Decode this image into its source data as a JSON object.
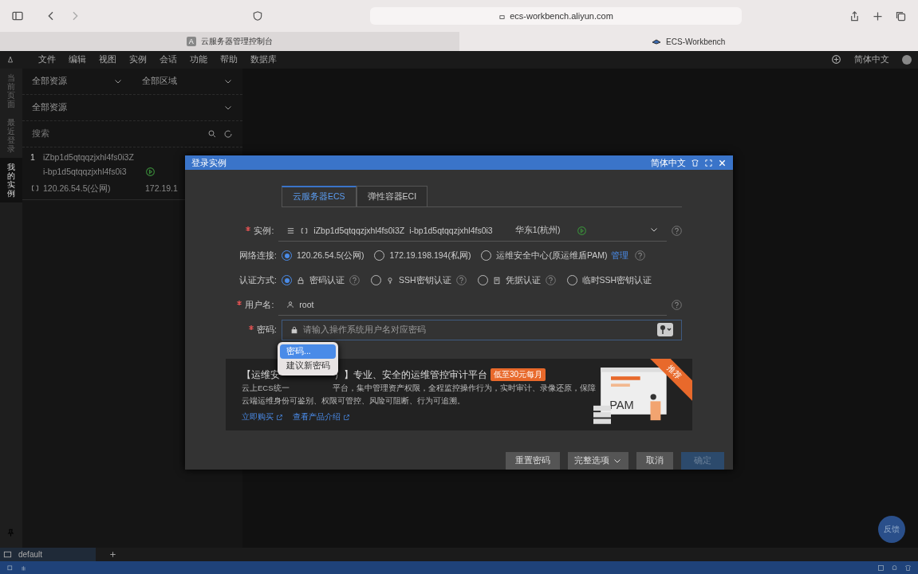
{
  "browser": {
    "url": "ecs-workbench.aliyun.com",
    "tabs": [
      {
        "label": "云服务器管理控制台",
        "badge": "A",
        "selected": false
      },
      {
        "label": "ECS-Workbench",
        "selected": true
      }
    ]
  },
  "menubar": {
    "items": [
      "文件",
      "编辑",
      "视图",
      "实例",
      "会话",
      "功能",
      "帮助",
      "数据库"
    ],
    "language": "简体中文"
  },
  "side_tabs": [
    {
      "label": "当前页面",
      "selected": false
    },
    {
      "label": "最近登录",
      "selected": false
    },
    {
      "label": "我的实例",
      "selected": true
    }
  ],
  "sidebar": {
    "filters": [
      [
        "全部资源",
        "全部区域"
      ],
      [
        "全部资源"
      ]
    ],
    "search": {
      "placeholder": "搜索"
    },
    "instances": [
      {
        "index": "1",
        "name": "iZbp1d5qtqqzjxhl4fs0i3Z",
        "id": "i-bp1d5qtqqzjxhl4fs0i3",
        "public_ip": "120.26.54.5(公网)",
        "private_ip": "172.19.1"
      }
    ]
  },
  "dialog": {
    "title": "登录实例",
    "language": "简体中文",
    "tabs": [
      {
        "label": "云服务器ECS",
        "selected": true
      },
      {
        "label": "弹性容器ECI",
        "selected": false
      }
    ],
    "instance": {
      "label": "实例:",
      "required": true,
      "name": "iZbp1d5qtqqzjxhl4fs0i3Z",
      "id": "i-bp1d5qtqqzjxhl4fs0i3",
      "region": "华东1(杭州)"
    },
    "network": {
      "label": "网络连接:",
      "options": [
        {
          "label": "120.26.54.5(公网)",
          "selected": true
        },
        {
          "label": "172.19.198.194(私网)",
          "selected": false
        },
        {
          "label": "运维安全中心(原运维盾PAM)",
          "selected": false,
          "link": "管理"
        }
      ]
    },
    "auth": {
      "label": "认证方式:",
      "options": [
        {
          "label": "密码认证",
          "kind": "password",
          "help": true,
          "selected": true
        },
        {
          "label": "SSH密钥认证",
          "kind": "ssh_key",
          "help": true,
          "selected": false
        },
        {
          "label": "凭据认证",
          "kind": "credential",
          "help": true,
          "selected": false
        },
        {
          "label": "临时SSH密钥认证",
          "kind": "temp_ssh",
          "help": false,
          "selected": false
        }
      ]
    },
    "username": {
      "label": "用户名:",
      "required": true,
      "value": "root"
    },
    "password": {
      "label": "密码:",
      "required": true,
      "placeholder": "请输入操作系统用户名对应密码"
    },
    "autofill_menu": [
      {
        "label": "密码...",
        "selected": true
      },
      {
        "label": "建议新密码",
        "selected": false
      }
    ],
    "banner": {
      "title_start": "【运维安",
      "title_end": "）】专业、安全的运维管控审计平台",
      "tag": "低至30元每月",
      "desc_start": "云上ECS统一",
      "desc_end": "平台，集中管理资产权限，全程监控操作行为，实时审计、录像还原，保障",
      "desc_line2": "云端运维身份可鉴别、权限可管控、风险可阻断、行为可追溯。",
      "links": [
        "立即购买",
        "查看产品介绍"
      ],
      "ribbon": "推荐",
      "art_label": "PAM"
    },
    "buttons": [
      {
        "label": "重置密码",
        "kind": "plain"
      },
      {
        "label": "完整选项",
        "kind": "dropdown"
      },
      {
        "label": "取消",
        "kind": "plain"
      },
      {
        "label": "确定",
        "kind": "primary",
        "disabled": true
      }
    ]
  },
  "feedback": "反馈",
  "terminal_tab": "default"
}
